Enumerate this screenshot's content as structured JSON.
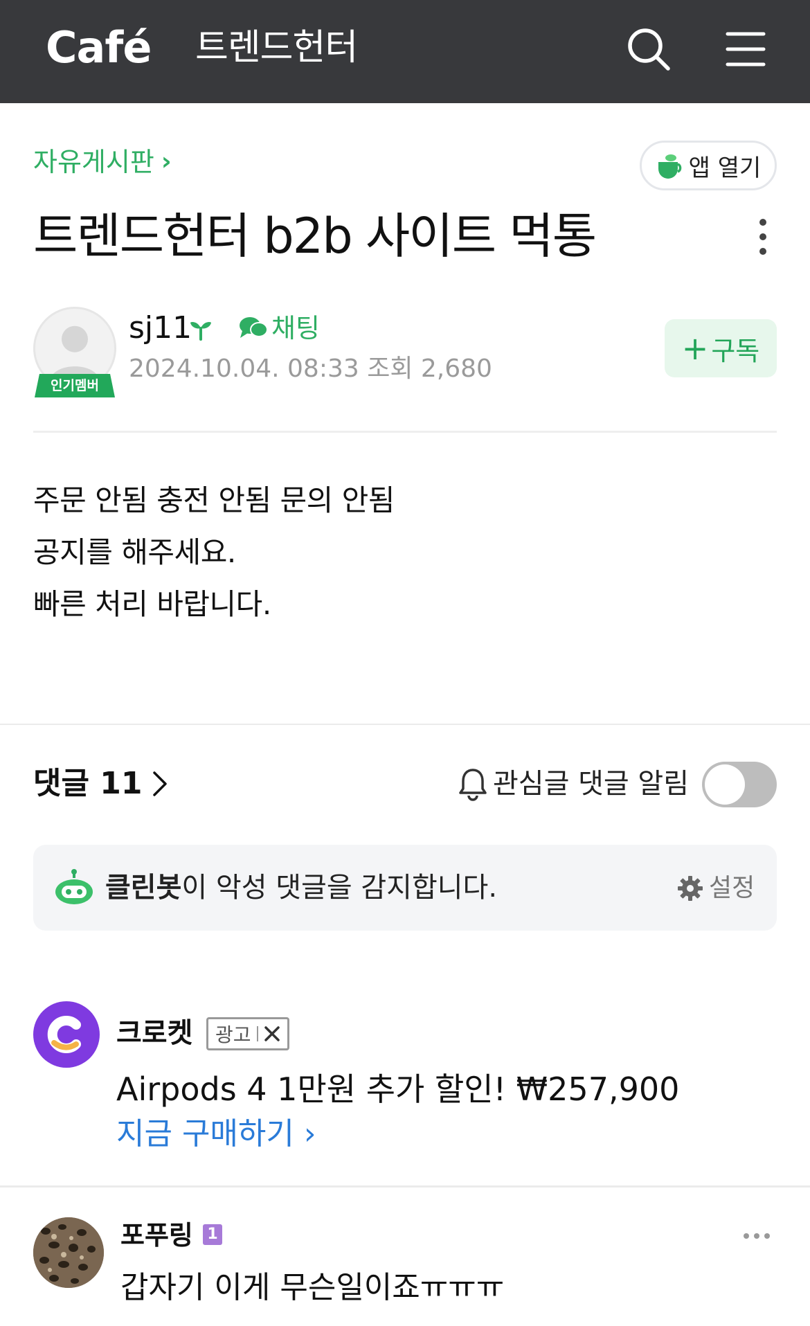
{
  "header": {
    "logo": "Café",
    "cafe_name": "트렌드헌터"
  },
  "post": {
    "board": "자유게시판",
    "app_open": "앱 열기",
    "title": "트렌드헌터 b2b 사이트 먹통",
    "author": "sj11",
    "author_badge": "인기멤버",
    "chat_label": "채팅",
    "date": "2024.10.04. 08:33",
    "views": "조회 2,680",
    "subscribe": "구독",
    "body": [
      "주문 안됨 충전 안됨 문의 안됨",
      "공지를 해주세요.",
      "빠른 처리 바랍니다."
    ]
  },
  "comments": {
    "title": "댓글 11",
    "notify_label": "관심글 댓글 알림",
    "notify_on": false,
    "cleanbot": {
      "name": "클린봇",
      "message": "이 악성 댓글을 감지합니다.",
      "settings": "설정"
    },
    "items": [
      {
        "author": "포푸링",
        "level": "1",
        "text": "갑자기 이게 무슨일이죠ㅠㅠㅠ"
      }
    ]
  },
  "ad": {
    "brand": "크로켓",
    "tag": "광고",
    "text": "Airpods 4 1만원 추가 할인! ₩257,900",
    "cta": "지금 구매하기",
    "cta_chevron": "›"
  },
  "colors": {
    "header_bg": "#38393c",
    "accent_green": "#2fae63",
    "link_blue": "#2a7bd8",
    "ad_purple": "#7f3ae0"
  }
}
